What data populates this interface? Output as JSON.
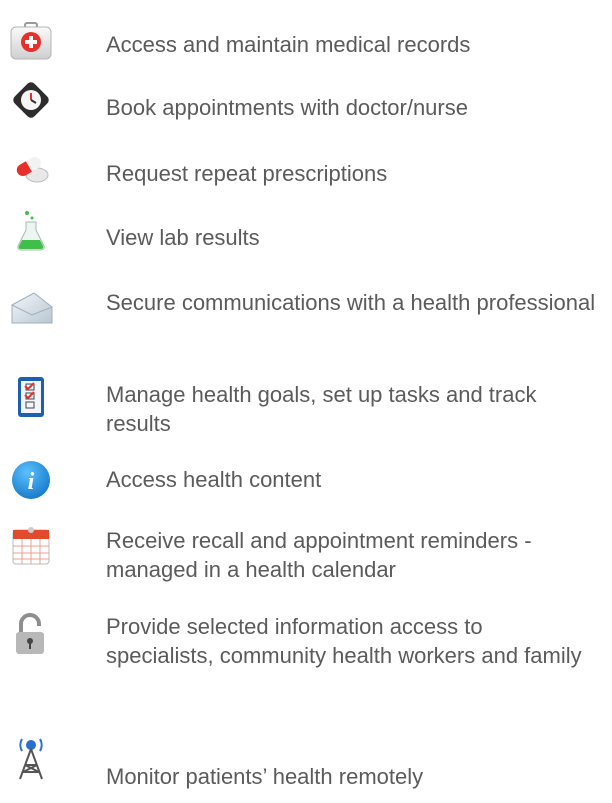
{
  "features": [
    {
      "icon": "medical-kit-icon",
      "text": "Access and maintain medical records"
    },
    {
      "icon": "clock-icon",
      "text": "Book appointments with doctor/nurse"
    },
    {
      "icon": "pills-icon",
      "text": "Request repeat prescriptions"
    },
    {
      "icon": "lab-flask-icon",
      "text": "View lab results"
    },
    {
      "icon": "envelope-icon",
      "text": "Secure communications with a health professional"
    },
    {
      "icon": "checklist-icon",
      "text": "Manage health goals, set up tasks and track results"
    },
    {
      "icon": "info-icon",
      "text": "Access health content"
    },
    {
      "icon": "calendar-icon",
      "text": "Receive recall and appointment reminders - managed in a health calendar"
    },
    {
      "icon": "padlock-icon",
      "text": "Provide selected information access to specialists, community health workers and family"
    },
    {
      "icon": "antenna-tower-icon",
      "text": "Monitor patients’ health remotely"
    }
  ],
  "colors": {
    "text": "#5b5b5b",
    "medical_red": "#e8302a",
    "info_blue": "#1c8fe0",
    "flask_green": "#3fbf4a"
  }
}
